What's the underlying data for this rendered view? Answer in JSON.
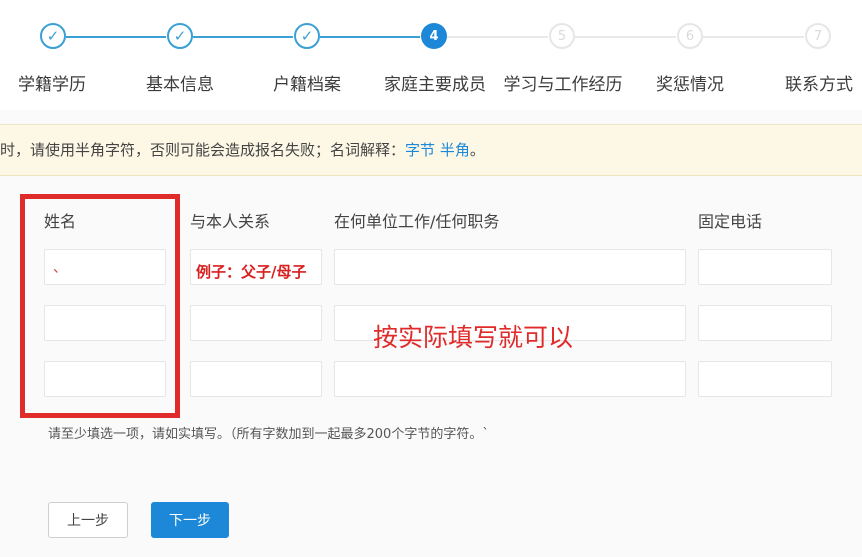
{
  "steps": [
    {
      "label": "学籍学历",
      "mark": "✓",
      "state": "done"
    },
    {
      "label": "基本信息",
      "mark": "✓",
      "state": "done"
    },
    {
      "label": "户籍档案",
      "mark": "✓",
      "state": "done"
    },
    {
      "label": "家庭主要成员",
      "mark": "4",
      "state": "active"
    },
    {
      "label": "学习与工作经历",
      "mark": "5",
      "state": "pending"
    },
    {
      "label": "奖惩情况",
      "mark": "6",
      "state": "pending"
    },
    {
      "label": "联系方式",
      "mark": "7",
      "state": "pending"
    }
  ],
  "notice": {
    "text": "时，请使用半角字符，否则可能会造成报名失败；名词解释：",
    "link_byte": "字节",
    "link_halfwidth": "半角",
    "end": "。"
  },
  "table": {
    "headers": {
      "name": "姓名",
      "relation": "与本人关系",
      "workplace": "在何单位工作/任何职务",
      "phone": "固定电话"
    },
    "rows": [
      {
        "name": "、",
        "relation": "",
        "workplace": "",
        "phone": ""
      },
      {
        "name": "",
        "relation": "",
        "workplace": "",
        "phone": ""
      },
      {
        "name": "",
        "relation": "",
        "workplace": "",
        "phone": ""
      }
    ],
    "relation_example": "例子：父子/母子"
  },
  "annotation": "按实际填写就可以",
  "hint": "请至少填选一项，请如实填写。（所有字数加到一起最多200个字节的字符。`",
  "buttons": {
    "prev": "上一步",
    "next": "下一步"
  },
  "colors": {
    "accent": "#1d88d8",
    "step_done": "#3aa0d5",
    "annotation_red": "#e02b2b",
    "notice_bg": "#fdf8e6"
  }
}
